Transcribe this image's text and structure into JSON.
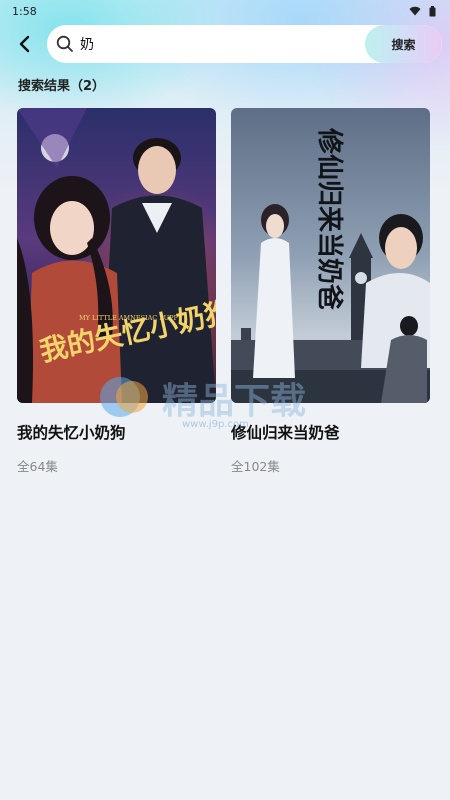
{
  "status_bar": {
    "time": "1:58"
  },
  "search": {
    "value": "奶",
    "button_label": "搜索"
  },
  "results": {
    "title": "搜索结果（2）",
    "items": [
      {
        "title": "我的失忆小奶狗",
        "episodes": "全64集",
        "poster_text": "我的失忆小奶狗",
        "poster_subtitle": "MY LITTLE AMNESIAC PUPPY"
      },
      {
        "title": "修仙归来当奶爸",
        "episodes": "全102集",
        "poster_text": "修仙归来当奶爸"
      }
    ]
  },
  "watermark": {
    "text": "精品下载",
    "url": "www.j9p.com"
  },
  "colors": {
    "search_button_start": "#bdf1ef",
    "search_button_end": "#ebcbf3",
    "background": "#eef1f5"
  }
}
